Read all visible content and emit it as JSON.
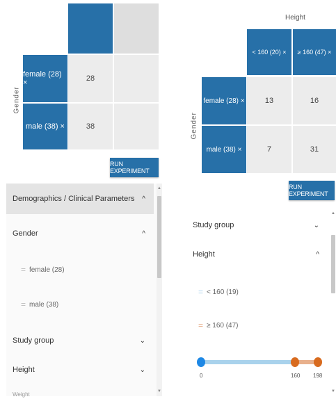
{
  "left": {
    "row_axis_label": "Gender",
    "rows": [
      {
        "label": "female (28) ×",
        "values": [
          "28",
          ""
        ]
      },
      {
        "label": "male (38) ×",
        "values": [
          "38",
          ""
        ]
      }
    ],
    "run_button": "RUN EXPERIMENT",
    "accordion": {
      "section_title": "Demographics / Clinical Parameters",
      "gender_title": "Gender",
      "gender_items": [
        "female (28)",
        "male (38)"
      ],
      "study_group": "Study group",
      "height": "Height",
      "cut_off": "Weight"
    }
  },
  "right": {
    "col_axis_label": "Height",
    "cols": [
      "< 160 (20) ×",
      "≥ 160 (47) ×"
    ],
    "row_axis_label": "Gender",
    "rows": [
      {
        "label": "female (28) ×",
        "values": [
          "13",
          "16"
        ]
      },
      {
        "label": "male (38) ×",
        "values": [
          "7",
          "31"
        ]
      }
    ],
    "run_button": "RUN EXPERIMENT",
    "accordion": {
      "study_group": "Study group",
      "height": "Height",
      "height_items": [
        {
          "label": "< 160 (19)",
          "color": "#a9d2ec"
        },
        {
          "label": "≥ 160 (47)",
          "color": "#e8b08c"
        }
      ],
      "slider": {
        "min_label": "0",
        "mid_label": "160",
        "max_label": "198",
        "min": 0,
        "split": 160,
        "max": 198
      }
    }
  },
  "colors": {
    "accent": "#2770a8",
    "cell_grey": "#ececec",
    "slider_blue": "#a9d2ec",
    "slider_orange": "#d86b1f"
  }
}
